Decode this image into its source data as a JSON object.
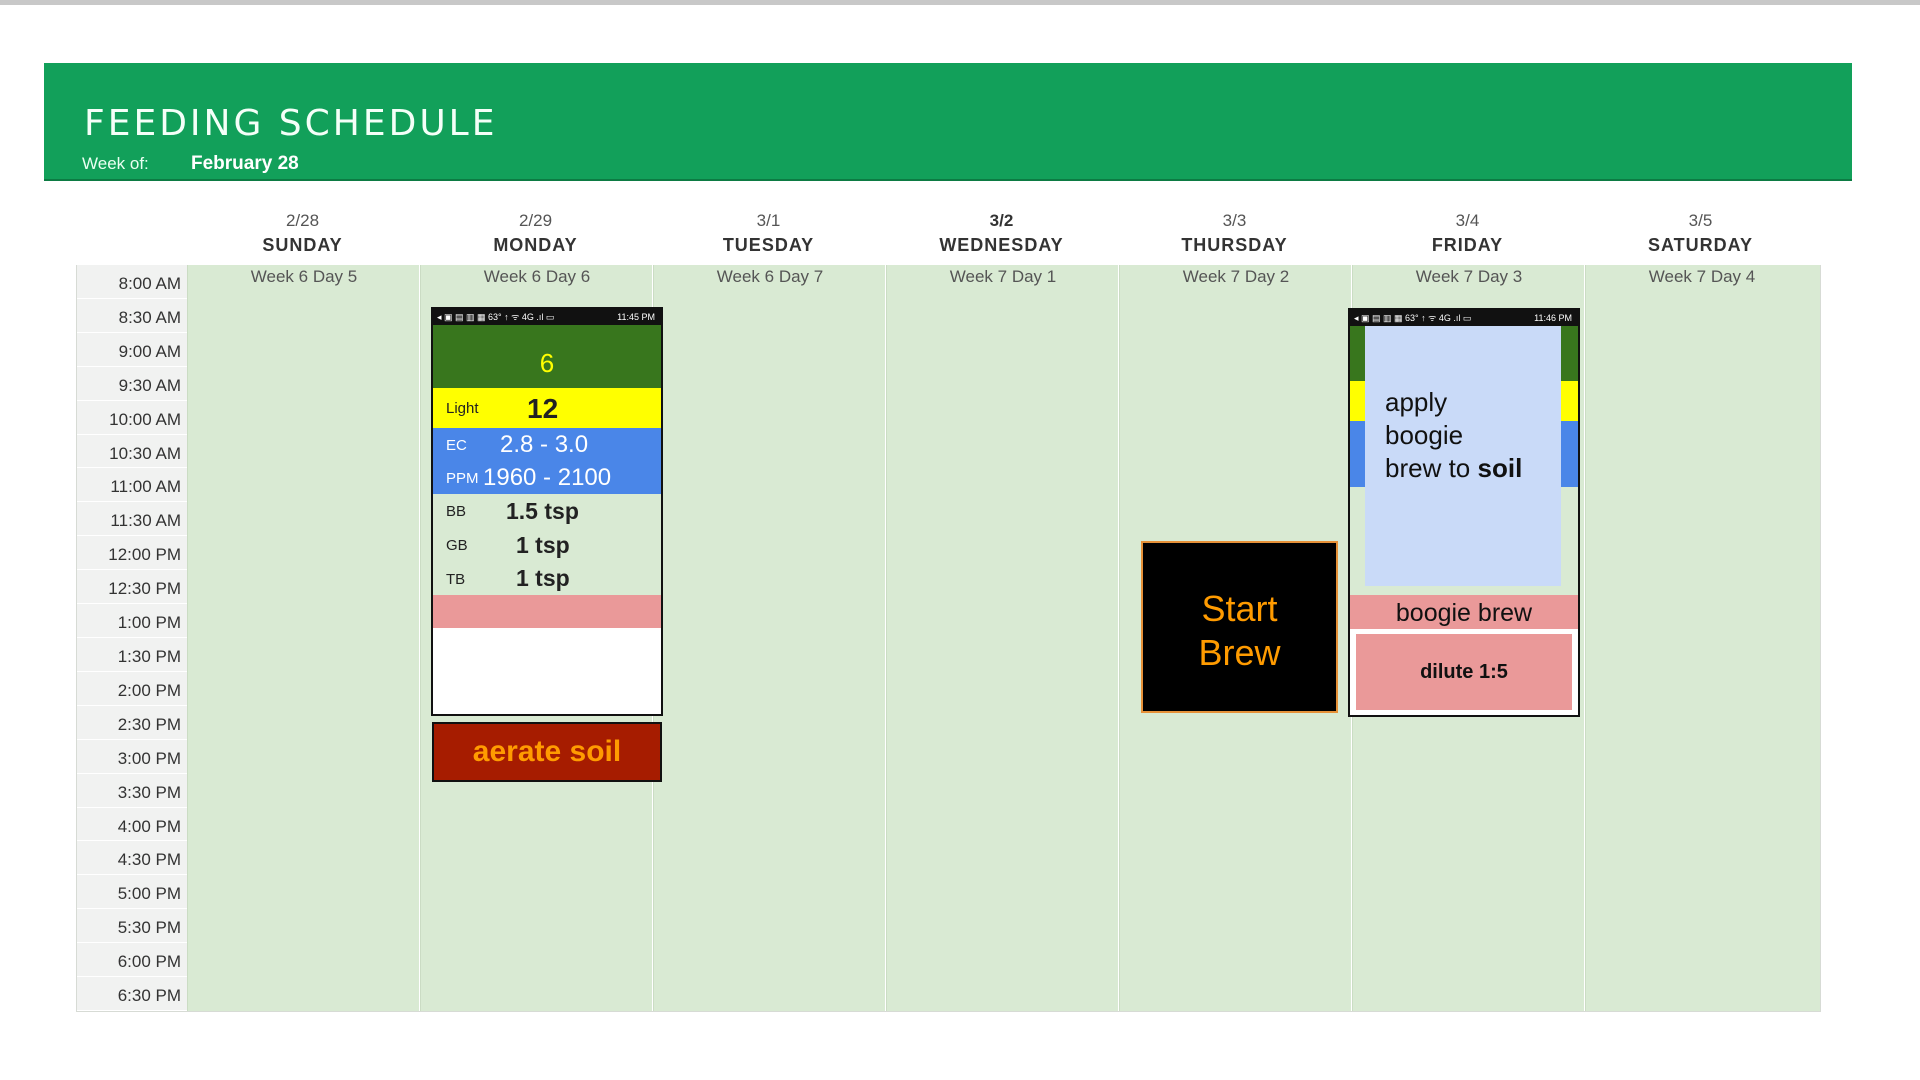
{
  "header": {
    "title": "FEEDING SCHEDULE",
    "week_of_label": "Week of:",
    "week_of_value": "February 28",
    "color": "#12a05a"
  },
  "days": [
    {
      "date": "2/28",
      "name": "SUNDAY",
      "week_day": "Week 6 Day 5"
    },
    {
      "date": "2/29",
      "name": "MONDAY",
      "week_day": "Week 6 Day 6"
    },
    {
      "date": "3/1",
      "name": "TUESDAY",
      "week_day": "Week 6 Day 7"
    },
    {
      "date": "3/2",
      "name": "WEDNESDAY",
      "week_day": "Week 7 Day 1"
    },
    {
      "date": "3/3",
      "name": "THURSDAY",
      "week_day": "Week 7 Day 2"
    },
    {
      "date": "3/4",
      "name": "FRIDAY",
      "week_day": "Week 7 Day 3"
    },
    {
      "date": "3/5",
      "name": "SATURDAY",
      "week_day": "Week 7 Day 4"
    }
  ],
  "times": [
    "8:00 AM",
    "8:30 AM",
    "9:00 AM",
    "9:30 AM",
    "10:00 AM",
    "10:30 AM",
    "11:00 AM",
    "11:30 AM",
    "12:00 PM",
    "12:30 PM",
    "1:00 PM",
    "1:30 PM",
    "2:00 PM",
    "2:30 PM",
    "3:00 PM",
    "3:30 PM",
    "4:00 PM",
    "4:30 PM",
    "5:00 PM",
    "5:30 PM",
    "6:00 PM",
    "6:30 PM"
  ],
  "monday_card": {
    "status_icons": "◂ ▣ ▤ ▥ ▦ 63° ↑   ᯤ 4G .ıl ▭",
    "status_time": "11:45 PM",
    "week_number": "6",
    "light_label": "Light",
    "light_value": "12",
    "ec_label": "EC",
    "ec_value": "2.8 - 3.0",
    "ppm_label": "PPM",
    "ppm_value": "1960 - 2100",
    "bb_label": "BB",
    "bb_value": "1.5 tsp",
    "gb_label": "GB",
    "gb_value": "1 tsp",
    "tb_label": "TB",
    "tb_value": "1 tsp"
  },
  "monday_event": "aerate soil",
  "thursday_event": {
    "line1": "Start",
    "line2": "Brew"
  },
  "friday_card": {
    "status_icons": "◂ ▣ ▤ ▥ ▦ 63° ↑   ᯤ 4G .ıl ▭",
    "status_time": "11:46 PM",
    "note_line1": "apply",
    "note_line2": "boogie",
    "note_line3_a": "brew to ",
    "note_line3_b": "soil",
    "brew_label": "boogie brew",
    "dilute_label": "dilute 1:5"
  },
  "colors": {
    "grid_fill": "#d9ead3",
    "card_green": "#38761d",
    "card_yellow": "#ffff00",
    "card_blue": "#4a86e8",
    "card_note": "#c9daf8",
    "card_pink": "#ea9999",
    "aerate_fill": "#a61c00",
    "accent_orange": "#ff9b00"
  }
}
